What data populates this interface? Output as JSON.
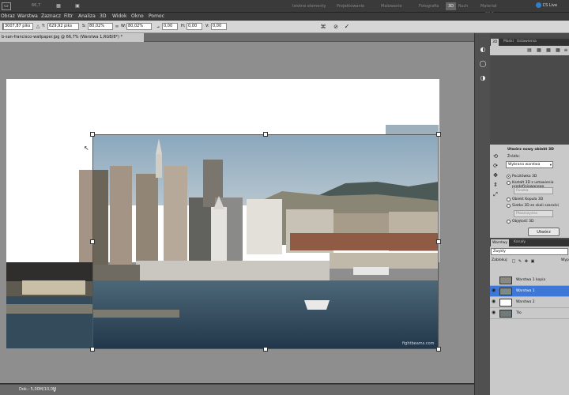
{
  "appbar": {
    "ps_logo": "Ps",
    "zoom": "66,7",
    "workspaces": [
      "Istotne elementy",
      "Projektowanie",
      "Malowanie",
      "Fotografia",
      "3D",
      "Ruch",
      "Materiał w CS 5"
    ],
    "active_workspace": "3D",
    "cslive": "CS Live"
  },
  "menu": [
    "Obraz",
    "Warstwa",
    "Zaznacz",
    "Filtr",
    "Analiza",
    "3D",
    "Widok",
    "Okno",
    "Pomoc"
  ],
  "options": {
    "x_label": "X:",
    "x_value": "3007,87 piks",
    "y_label": "Y:",
    "y_value": "629,92 piks",
    "w_label": "S:",
    "w_value": "80,02%",
    "h_label": "W:",
    "h_value": "80,02%",
    "angle_value": "0,00",
    "hskew_label": "H:",
    "hskew_value": "0,00",
    "vskew_label": "V:",
    "vskew_value": "0,00"
  },
  "doc_tab": {
    "title": "b-san-francisco-wallpaper.jpg @ 66,7% (Warstwa 1,RGB/8*) *"
  },
  "status": {
    "doc": "Dok.: 5,00M/10,0M"
  },
  "photo": {
    "watermark": "fightbeams.com"
  },
  "dock_top_tabs": [
    "3D",
    "Maski",
    "Ustawienia"
  ],
  "panel3d": {
    "title": "Utwórz nowy obiekt 3D",
    "source_label": "Źródło:",
    "source_value": "Wybrana warstwa",
    "options": [
      "Pocztówka 3D",
      "Kształt 3D z ustawienia predefiniowanego",
      "Obiekt Kopuła 3D",
      "Siatka 3D ze skali szarości",
      "Objętość 3D"
    ],
    "preset_a": "Puszka",
    "preset_b": "Płaszczyzna",
    "create_button": "Utwórz"
  },
  "layers": {
    "tabs": [
      "Warstwy",
      "Kanały"
    ],
    "blend_mode": "Zwykły",
    "lock_label": "Zablokuj:",
    "fill_label": "Wyp",
    "items": [
      {
        "name": "Warstwa 1 kopia",
        "visible": false
      },
      {
        "name": "Warstwa 1",
        "visible": true
      },
      {
        "name": "Warstwa 2",
        "visible": true
      },
      {
        "name": "Tło",
        "visible": true
      }
    ]
  },
  "colors": {
    "accent": "#3d78d8",
    "chrome": "#3a3a3a",
    "panel": "#c9c9c9"
  }
}
